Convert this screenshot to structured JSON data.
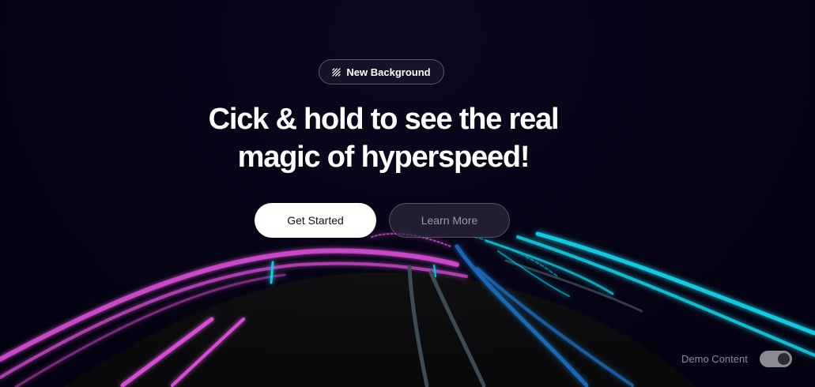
{
  "badge": {
    "label": "New Background",
    "icon": "diagonal-lines-icon"
  },
  "hero": {
    "headline_line1": "Cick & hold to see the real",
    "headline_line2": "magic of hyperspeed!"
  },
  "buttons": {
    "primary_label": "Get Started",
    "secondary_label": "Learn More"
  },
  "demo_toggle": {
    "label": "Demo Content",
    "enabled": true
  },
  "colors": {
    "background": "#060313",
    "road": "#0b0b0d",
    "magenta_lights": "#d24fd0",
    "cyan_lights": "#17c7de",
    "blue_lights": "#1f6fc0",
    "gray_lights": "#3c4b55"
  }
}
